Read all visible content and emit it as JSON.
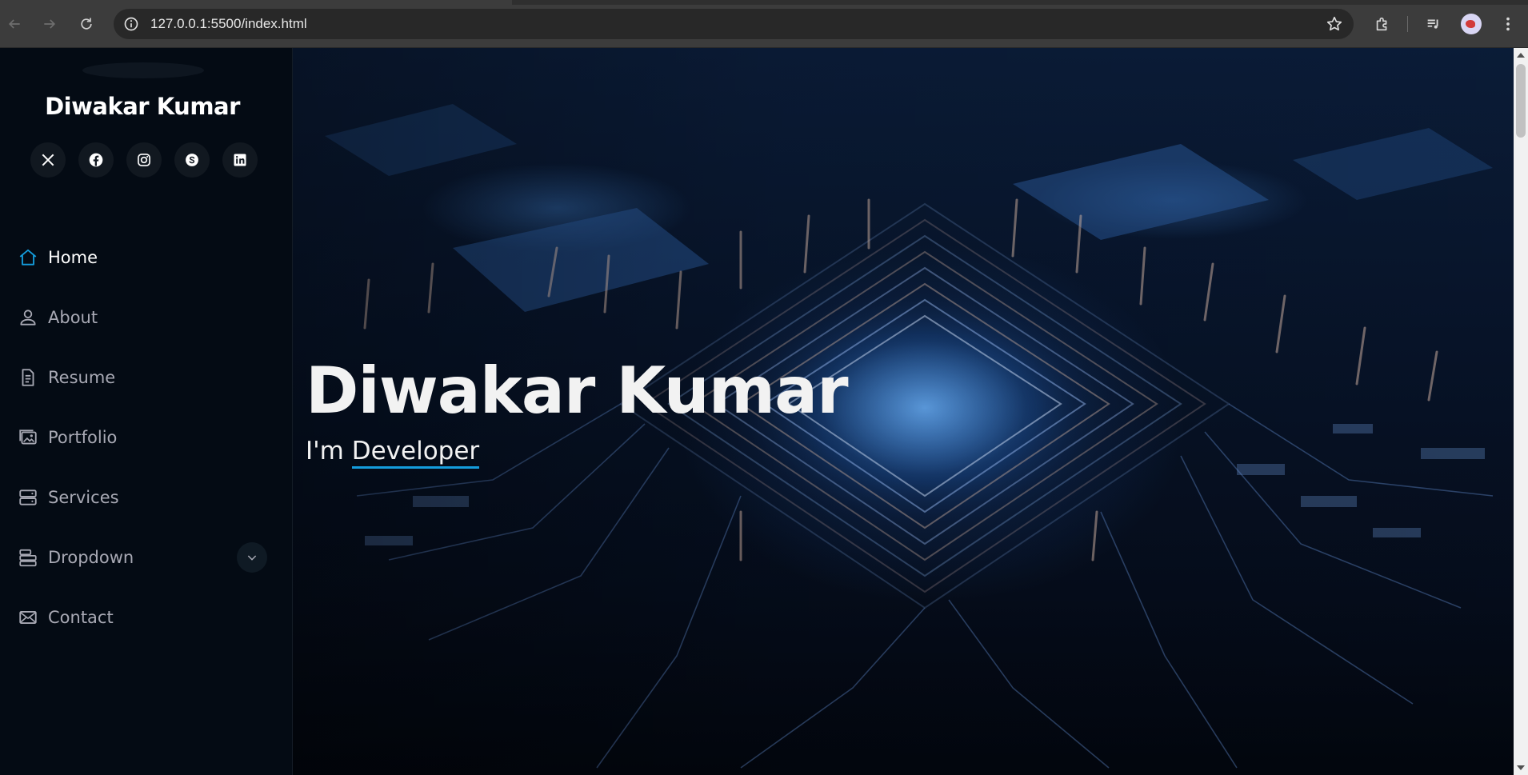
{
  "browser": {
    "url": "127.0.0.1:5500/index.html"
  },
  "sidebar": {
    "site_name": "Diwakar Kumar",
    "socials": [
      {
        "name": "x-twitter-icon"
      },
      {
        "name": "facebook-icon"
      },
      {
        "name": "instagram-icon"
      },
      {
        "name": "skype-icon"
      },
      {
        "name": "linkedin-icon"
      }
    ],
    "nav": [
      {
        "label": "Home",
        "icon": "home-icon",
        "active": true
      },
      {
        "label": "About",
        "icon": "person-icon"
      },
      {
        "label": "Resume",
        "icon": "file-text-icon"
      },
      {
        "label": "Portfolio",
        "icon": "images-icon"
      },
      {
        "label": "Services",
        "icon": "hdd-stack-icon"
      },
      {
        "label": "Dropdown",
        "icon": "menu-list-icon",
        "has_toggle": true
      },
      {
        "label": "Contact",
        "icon": "envelope-icon"
      }
    ]
  },
  "hero": {
    "title": "Diwakar Kumar",
    "prefix": "I'm",
    "typed": "Developer"
  },
  "colors": {
    "accent": "#149ddd",
    "sidebar_bg": "#040b14",
    "nav_text": "#a8a9b4"
  }
}
